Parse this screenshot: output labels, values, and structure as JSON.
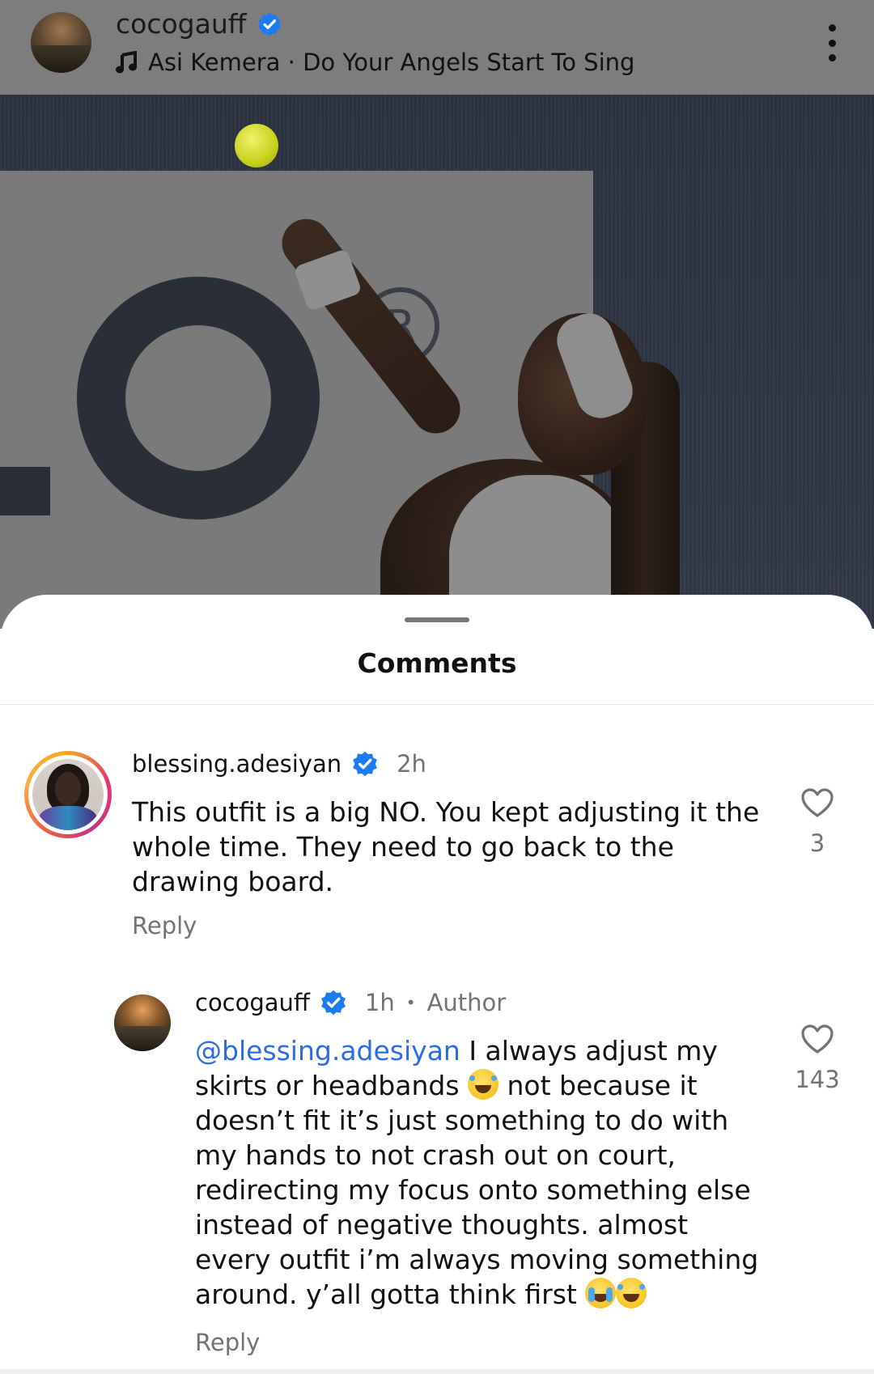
{
  "post": {
    "username": "cocogauff",
    "music": "Asi Kemera · Do Your Angels Start To Sing",
    "photo_sign_letter": "R"
  },
  "sheet": {
    "title": "Comments"
  },
  "comments": [
    {
      "username": "blessing.adesiyan",
      "time": "2h",
      "text": "This outfit is a big NO. You kept adjusting it the whole time. They need to go back to the drawing board.",
      "reply_label": "Reply",
      "likes": "3"
    },
    {
      "username": "cocogauff",
      "time": "1h",
      "dot": "•",
      "author_label": "Author",
      "mention": "@blessing.adesiyan",
      "text_part1": " I always adjust my skirts or headbands ",
      "text_part2": " not because it doesn’t fit it’s just something to do with my hands to not crash out on court, redirecting my focus onto something else instead of negative thoughts. almost every outfit i’m always moving something around. y’all gotta think first ",
      "reply_label": "Reply",
      "likes": "143"
    }
  ],
  "colors": {
    "mention": "#2b6ce6",
    "verified": "#1d7bf0",
    "muted": "#737373"
  },
  "icons": [
    "verified-badge-icon",
    "music-note-icon",
    "more-options-icon",
    "heart-icon",
    "laughing-emoji",
    "crying-emoji"
  ]
}
